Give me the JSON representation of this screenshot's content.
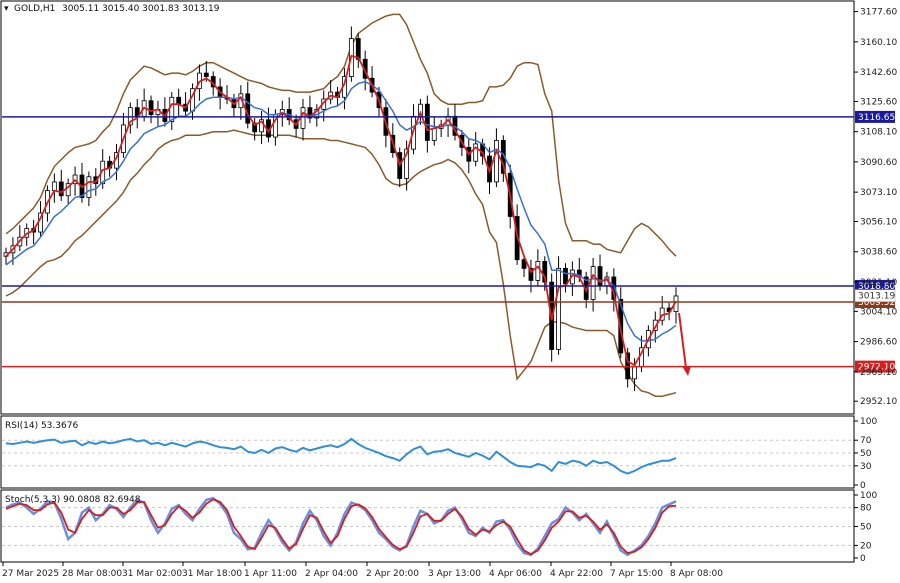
{
  "header": {
    "symbol": "GOLD,H1",
    "ohlc": "3005.11 3015.40 3001.83 3013.19"
  },
  "chart_data": {
    "type": "candlestick",
    "main": {
      "ylim": [
        2947,
        3182
      ],
      "y_ticks": [
        "3177.60",
        "3160.10",
        "3142.60",
        "3125.60",
        "3108.10",
        "3090.60",
        "3073.10",
        "3056.10",
        "3038.60",
        "3021.10",
        "3004.10",
        "2986.60",
        "2969.10",
        "2952.10"
      ],
      "levels": [
        {
          "value": 3116.65,
          "label": "3116.65",
          "color": "#1a1aa0"
        },
        {
          "value": 3018.8,
          "label": "3018.80",
          "color": "#1a1aa0"
        },
        {
          "value": 3009.52,
          "label": "3009.52",
          "color": "#8b3a1a"
        },
        {
          "value": 2972.1,
          "label": "2972.10",
          "color": "#d42020"
        }
      ],
      "current_price_label": "3013.19",
      "close": [
        3038,
        3042,
        3047,
        3052,
        3050,
        3061,
        3074,
        3079,
        3071,
        3078,
        3083,
        3070,
        3082,
        3078,
        3091,
        3087,
        3096,
        3112,
        3122,
        3117,
        3126,
        3118,
        3121,
        3114,
        3128,
        3124,
        3120,
        3133,
        3142,
        3140,
        3134,
        3128,
        3127,
        3122,
        3130,
        3113,
        3108,
        3115,
        3105,
        3118,
        3121,
        3115,
        3110,
        3122,
        3116,
        3121,
        3127,
        3131,
        3128,
        3140,
        3162,
        3150,
        3139,
        3131,
        3122,
        3106,
        3096,
        3081,
        3098,
        3117,
        3124,
        3103,
        3110,
        3112,
        3117,
        3106,
        3099,
        3091,
        3101,
        3094,
        3079,
        3103,
        3084,
        3059,
        3034,
        3029,
        3022,
        3033,
        3021,
        2982,
        3029,
        3020,
        3028,
        3024,
        3011,
        3030,
        3019,
        3024,
        3011,
        2980,
        2965,
        2972,
        2983,
        2993,
        2999,
        3006,
        3004,
        3013
      ],
      "ema_fast": [
        3036,
        3040,
        3045,
        3049,
        3051,
        3058,
        3067,
        3074,
        3073,
        3076,
        3080,
        3076,
        3079,
        3079,
        3086,
        3087,
        3093,
        3104,
        3114,
        3116,
        3122,
        3120,
        3121,
        3117,
        3124,
        3124,
        3122,
        3129,
        3137,
        3139,
        3136,
        3131,
        3128,
        3124,
        3128,
        3118,
        3112,
        3114,
        3108,
        3115,
        3119,
        3116,
        3112,
        3119,
        3117,
        3120,
        3125,
        3129,
        3128,
        3136,
        3152,
        3151,
        3143,
        3135,
        3126,
        3113,
        3102,
        3089,
        3095,
        3109,
        3119,
        3109,
        3110,
        3111,
        3115,
        3109,
        3102,
        3095,
        3099,
        3096,
        3085,
        3097,
        3089,
        3071,
        3048,
        3036,
        3027,
        3030,
        3024,
        2999,
        3018,
        3019,
        3025,
        3024,
        3016,
        3025,
        3021,
        3023,
        3015,
        2993,
        2975,
        2973,
        2980,
        2988,
        2995,
        3002,
        3003,
        3010
      ],
      "ema_slow": [
        3031,
        3034,
        3037,
        3040,
        3042,
        3047,
        3053,
        3059,
        3062,
        3066,
        3070,
        3071,
        3074,
        3075,
        3079,
        3081,
        3085,
        3091,
        3098,
        3102,
        3107,
        3109,
        3111,
        3112,
        3115,
        3117,
        3117,
        3120,
        3124,
        3127,
        3128,
        3128,
        3128,
        3127,
        3128,
        3125,
        3122,
        3121,
        3118,
        3118,
        3119,
        3118,
        3116,
        3117,
        3117,
        3118,
        3120,
        3122,
        3123,
        3126,
        3133,
        3136,
        3137,
        3135,
        3132,
        3126,
        3120,
        3112,
        3109,
        3111,
        3114,
        3112,
        3111,
        3111,
        3112,
        3111,
        3108,
        3104,
        3103,
        3101,
        3096,
        3098,
        3095,
        3087,
        3075,
        3064,
        3054,
        3049,
        3043,
        3028,
        3028,
        3026,
        3026,
        3025,
        3022,
        3023,
        3022,
        3022,
        3019,
        3008,
        2997,
        2990,
        2987,
        2987,
        2988,
        2991,
        2993,
        2996
      ],
      "bb_upper": [
        3049,
        3052,
        3056,
        3060,
        3064,
        3070,
        3080,
        3088,
        3092,
        3096,
        3099,
        3100,
        3101,
        3103,
        3108,
        3112,
        3120,
        3130,
        3138,
        3142,
        3146,
        3145,
        3143,
        3141,
        3142,
        3142,
        3141,
        3143,
        3146,
        3148,
        3148,
        3146,
        3144,
        3142,
        3140,
        3138,
        3137,
        3136,
        3134,
        3133,
        3132,
        3132,
        3131,
        3131,
        3131,
        3132,
        3133,
        3137,
        3140,
        3146,
        3158,
        3165,
        3168,
        3171,
        3173,
        3175,
        3176,
        3176,
        3170,
        3160,
        3150,
        3142,
        3130,
        3126,
        3124,
        3124,
        3124,
        3125,
        3125,
        3126,
        3134,
        3134,
        3135,
        3139,
        3146,
        3148,
        3148,
        3147,
        3130,
        3120,
        3080,
        3055,
        3045,
        3045,
        3045,
        3043,
        3043,
        3040,
        3039,
        3038,
        3045,
        3052,
        3055,
        3053,
        3049,
        3045,
        3040,
        3036
      ],
      "bb_lower": [
        3013,
        3015,
        3018,
        3022,
        3026,
        3030,
        3033,
        3034,
        3036,
        3040,
        3045,
        3048,
        3052,
        3056,
        3060,
        3064,
        3068,
        3073,
        3080,
        3084,
        3089,
        3093,
        3098,
        3101,
        3103,
        3104,
        3106,
        3106,
        3106,
        3107,
        3108,
        3108,
        3108,
        3109,
        3108,
        3107,
        3106,
        3106,
        3106,
        3106,
        3106,
        3106,
        3105,
        3104,
        3104,
        3104,
        3104,
        3103,
        3103,
        3102,
        3101,
        3100,
        3099,
        3095,
        3089,
        3081,
        3078,
        3077,
        3078,
        3082,
        3085,
        3087,
        3089,
        3090,
        3092,
        3090,
        3086,
        3080,
        3072,
        3066,
        3050,
        3044,
        3020,
        2990,
        2965,
        2970,
        2975,
        2985,
        2995,
        2998,
        2998,
        2997,
        2995,
        2994,
        2993,
        2993,
        2993,
        2993,
        2990,
        2975,
        2968,
        2962,
        2958,
        2957,
        2955,
        2955,
        2956,
        2957
      ]
    },
    "rsi": {
      "label": "RSI(14) 53.3676",
      "ylim": [
        0,
        100
      ],
      "y_ticks": [
        "100",
        "70",
        "50",
        "30",
        "0"
      ],
      "levels": [
        70,
        50,
        30
      ],
      "values": [
        65,
        64,
        66,
        68,
        66,
        68,
        70,
        71,
        66,
        68,
        69,
        62,
        67,
        64,
        68,
        65,
        67,
        70,
        72,
        68,
        70,
        64,
        66,
        62,
        66,
        63,
        60,
        65,
        68,
        66,
        62,
        59,
        58,
        56,
        60,
        52,
        50,
        55,
        50,
        57,
        59,
        55,
        52,
        58,
        54,
        57,
        60,
        62,
        59,
        64,
        72,
        64,
        58,
        54,
        50,
        45,
        42,
        38,
        48,
        56,
        60,
        48,
        52,
        53,
        56,
        50,
        47,
        44,
        50,
        46,
        40,
        52,
        44,
        36,
        30,
        29,
        28,
        33,
        30,
        22,
        36,
        33,
        38,
        36,
        30,
        38,
        34,
        36,
        30,
        22,
        18,
        22,
        28,
        32,
        35,
        38,
        38,
        42
      ]
    },
    "stoch": {
      "label": "Stoch(5,3,3) 90.0808 82.6948",
      "ylim": [
        0,
        100
      ],
      "y_ticks": [
        "100",
        "80",
        "50",
        "20",
        "0"
      ],
      "levels": [
        80,
        50,
        20
      ],
      "main": [
        80,
        85,
        88,
        80,
        70,
        78,
        90,
        88,
        62,
        30,
        40,
        72,
        80,
        60,
        70,
        84,
        78,
        65,
        80,
        92,
        88,
        60,
        40,
        55,
        78,
        84,
        70,
        60,
        78,
        92,
        95,
        86,
        70,
        40,
        30,
        14,
        16,
        40,
        60,
        45,
        25,
        12,
        25,
        55,
        75,
        60,
        35,
        20,
        40,
        70,
        88,
        84,
        76,
        60,
        40,
        30,
        18,
        12,
        20,
        50,
        75,
        70,
        55,
        60,
        75,
        80,
        62,
        40,
        35,
        48,
        40,
        58,
        60,
        45,
        22,
        8,
        5,
        15,
        35,
        55,
        62,
        80,
        72,
        60,
        70,
        55,
        40,
        58,
        35,
        12,
        5,
        12,
        20,
        35,
        55,
        80,
        85,
        90
      ],
      "signal": [
        78,
        82,
        86,
        84,
        76,
        76,
        85,
        88,
        72,
        45,
        40,
        62,
        76,
        68,
        68,
        80,
        80,
        70,
        76,
        88,
        89,
        68,
        48,
        52,
        70,
        82,
        75,
        64,
        72,
        86,
        93,
        89,
        76,
        50,
        35,
        18,
        14,
        32,
        52,
        48,
        30,
        15,
        22,
        46,
        68,
        64,
        42,
        24,
        35,
        62,
        82,
        85,
        79,
        65,
        46,
        33,
        21,
        14,
        18,
        40,
        66,
        70,
        59,
        59,
        70,
        78,
        66,
        46,
        37,
        45,
        42,
        52,
        58,
        50,
        30,
        12,
        6,
        12,
        28,
        48,
        58,
        74,
        74,
        64,
        67,
        58,
        45,
        53,
        40,
        18,
        8,
        10,
        17,
        30,
        48,
        72,
        82,
        83
      ]
    },
    "x_ticks": [
      "27 Mar 2025",
      "28 Mar 08:00",
      "31 Mar 02:00",
      "31 Mar 18:00",
      "1 Apr 11:00",
      "2 Apr 04:00",
      "2 Apr 20:00",
      "3 Apr 13:00",
      "4 Apr 06:00",
      "4 Apr 22:00",
      "7 Apr 15:00",
      "8 Apr 08:00"
    ]
  }
}
